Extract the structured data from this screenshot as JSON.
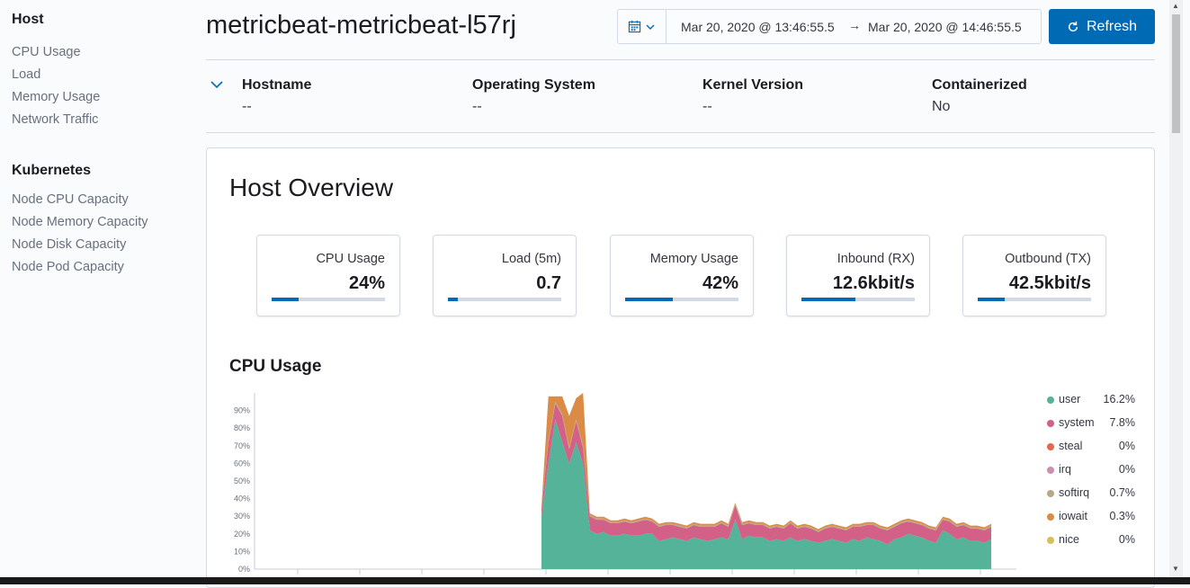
{
  "sidebar": {
    "host_heading": "Host",
    "host_items": [
      "CPU Usage",
      "Load",
      "Memory Usage",
      "Network Traffic"
    ],
    "kube_heading": "Kubernetes",
    "kube_items": [
      "Node CPU Capacity",
      "Node Memory Capacity",
      "Node Disk Capacity",
      "Node Pod Capacity"
    ]
  },
  "header": {
    "title": "metricbeat-metricbeat-l57rj",
    "date_start": "Mar 20, 2020 @ 13:46:55.5",
    "date_arrow": "→",
    "date_end": "Mar 20, 2020 @ 14:46:55.5",
    "refresh_label": "Refresh",
    "icon_calendar": "calendar-icon",
    "icon_refresh": "refresh-icon"
  },
  "metadata": [
    {
      "label": "Hostname",
      "value": "--"
    },
    {
      "label": "Operating System",
      "value": "--"
    },
    {
      "label": "Kernel Version",
      "value": "--"
    },
    {
      "label": "Containerized",
      "value": "No"
    }
  ],
  "overview": {
    "title": "Host Overview",
    "kpis": [
      {
        "label": "CPU Usage",
        "value": "24%",
        "fill": 0.24
      },
      {
        "label": "Load (5m)",
        "value": "0.7",
        "fill": 0.09
      },
      {
        "label": "Memory Usage",
        "value": "42%",
        "fill": 0.42
      },
      {
        "label": "Inbound (RX)",
        "value": "12.6kbit/s",
        "fill": 0.48
      },
      {
        "label": "Outbound (TX)",
        "value": "42.5kbit/s",
        "fill": 0.24
      }
    ],
    "cpu_section_title": "CPU Usage",
    "legend": [
      {
        "name": "user",
        "value": "16.2%",
        "color": "#54b399"
      },
      {
        "name": "system",
        "value": "7.8%",
        "color": "#d36086"
      },
      {
        "name": "steal",
        "value": "0%",
        "color": "#e7664c"
      },
      {
        "name": "irq",
        "value": "0%",
        "color": "#ca8eae"
      },
      {
        "name": "softirq",
        "value": "0.7%",
        "color": "#b9a888"
      },
      {
        "name": "iowait",
        "value": "0.3%",
        "color": "#da8b45"
      },
      {
        "name": "nice",
        "value": "0%",
        "color": "#d6bf57"
      }
    ]
  },
  "chart_data": {
    "type": "area",
    "title": "CPU Usage",
    "ylim": [
      0,
      100
    ],
    "y_ticks": [
      "0%",
      "10%",
      "20%",
      "30%",
      "40%",
      "50%",
      "60%",
      "70%",
      "80%",
      "90%"
    ],
    "stacked": true,
    "series": [
      {
        "name": "user",
        "color": "#54b399",
        "values": [
          30,
          60,
          85,
          72,
          60,
          72,
          60,
          22,
          20,
          21,
          19,
          19,
          20,
          19,
          19,
          20,
          20,
          16,
          17,
          18,
          17,
          16,
          18,
          17,
          16,
          17,
          18,
          17,
          28,
          17,
          19,
          18,
          18,
          16,
          17,
          16,
          18,
          16,
          17,
          16,
          15,
          16,
          17,
          16,
          15,
          17,
          16,
          18,
          17,
          16,
          14,
          17,
          18,
          20,
          19,
          18,
          16,
          15,
          22,
          20,
          17,
          18,
          16,
          16,
          15,
          17
        ]
      },
      {
        "name": "system",
        "color": "#d36086",
        "values": [
          4,
          12,
          9,
          15,
          8,
          12,
          9,
          8,
          8,
          7,
          7,
          7,
          7,
          7,
          8,
          8,
          7,
          8,
          8,
          7,
          7,
          7,
          7,
          7,
          8,
          7,
          8,
          7,
          8,
          8,
          7,
          7,
          7,
          7,
          7,
          7,
          8,
          7,
          7,
          7,
          6,
          7,
          7,
          7,
          7,
          7,
          8,
          7,
          8,
          7,
          8,
          7,
          8,
          7,
          7,
          7,
          7,
          7,
          6,
          7,
          7,
          7,
          7,
          7,
          7,
          7
        ]
      },
      {
        "name": "softirq",
        "color": "#b9a888",
        "values": [
          0.5,
          1,
          1,
          1,
          1,
          1,
          1,
          0.7,
          0.7,
          0.7,
          0.7,
          0.7,
          0.7,
          0.7,
          0.7,
          0.7,
          0.7,
          0.7,
          0.7,
          0.7,
          0.7,
          0.7,
          0.7,
          0.7,
          0.7,
          0.7,
          0.7,
          0.7,
          0.7,
          0.7,
          0.7,
          0.7,
          0.7,
          0.7,
          0.7,
          0.7,
          0.7,
          0.7,
          0.7,
          0.7,
          0.7,
          0.7,
          0.7,
          0.7,
          0.7,
          0.7,
          0.7,
          0.7,
          0.7,
          0.7,
          0.7,
          0.7,
          0.7,
          0.7,
          0.7,
          0.7,
          0.7,
          0.7,
          0.7,
          0.7,
          0.7,
          0.7,
          0.7,
          0.7,
          0.7,
          0.7
        ]
      },
      {
        "name": "iowait",
        "color": "#da8b45",
        "values": [
          1,
          25,
          3,
          10,
          18,
          12,
          30,
          1,
          1,
          1,
          1,
          1,
          1,
          1,
          1,
          1,
          1,
          1,
          1,
          1,
          1,
          1,
          1,
          1,
          1,
          1,
          1,
          1,
          1,
          1,
          1,
          1,
          1,
          1,
          1,
          1,
          1,
          1,
          1,
          1,
          1,
          1,
          1,
          1,
          1,
          1,
          1,
          1,
          1,
          1,
          1,
          1,
          1,
          1,
          1,
          1,
          1,
          1,
          1,
          1,
          1,
          1,
          1,
          1,
          1,
          1
        ]
      }
    ]
  }
}
